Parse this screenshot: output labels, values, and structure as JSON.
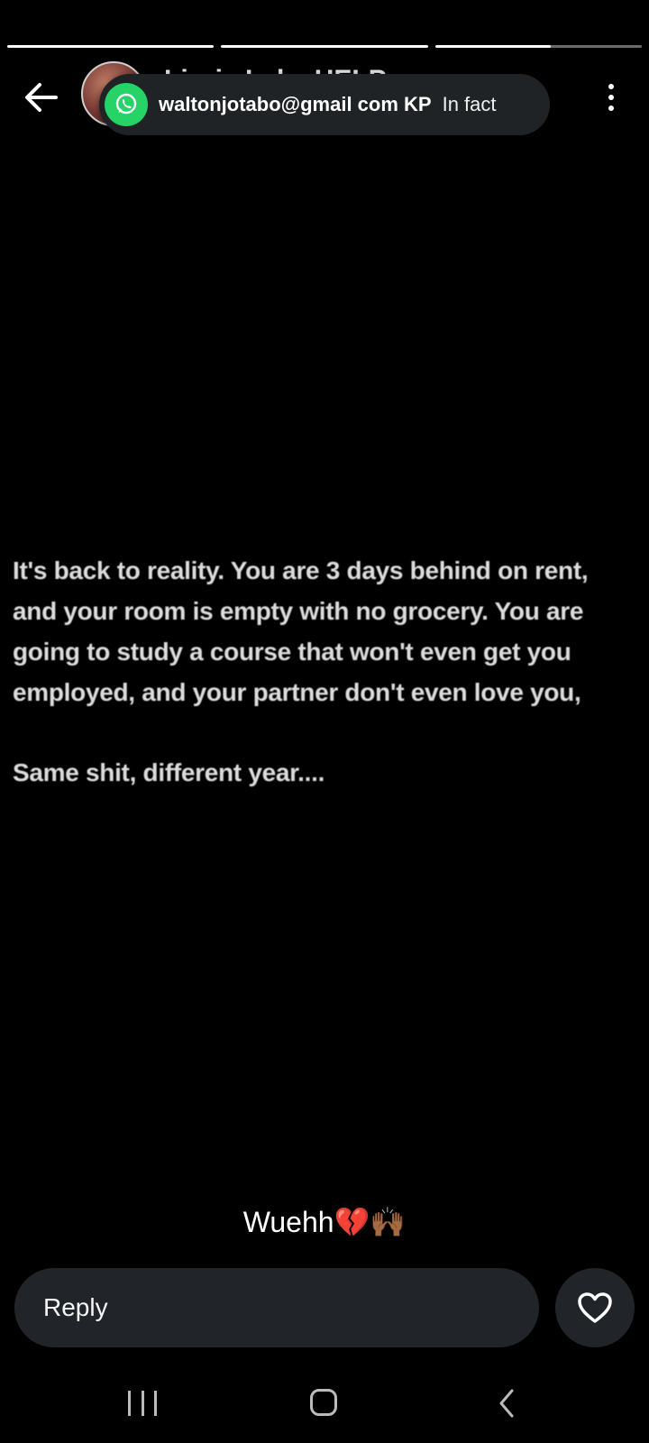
{
  "story": {
    "progress": [
      1.0,
      1.0,
      0.56
    ],
    "author_name_partial": "Lizzie Lake HELP",
    "text_paragraphs": [
      "It's back to reality. You are 3 days behind on rent, and your room is empty with no grocery. You are going to study a course that won't even get you employed, and your partner don't even love you,",
      "Same shit, different year...."
    ],
    "caption": "Wuehh💔🙌🏾"
  },
  "notification": {
    "app_icon": "whatsapp-icon",
    "sender": "waltonjotabo@gmail com KP",
    "message": "In fact"
  },
  "reply": {
    "placeholder": "Reply",
    "value": ""
  },
  "icons": {
    "back": "arrow-left-icon",
    "more": "more-vertical-icon",
    "like": "heart-icon"
  },
  "navbar": {
    "items": [
      "recents",
      "home",
      "back"
    ]
  }
}
